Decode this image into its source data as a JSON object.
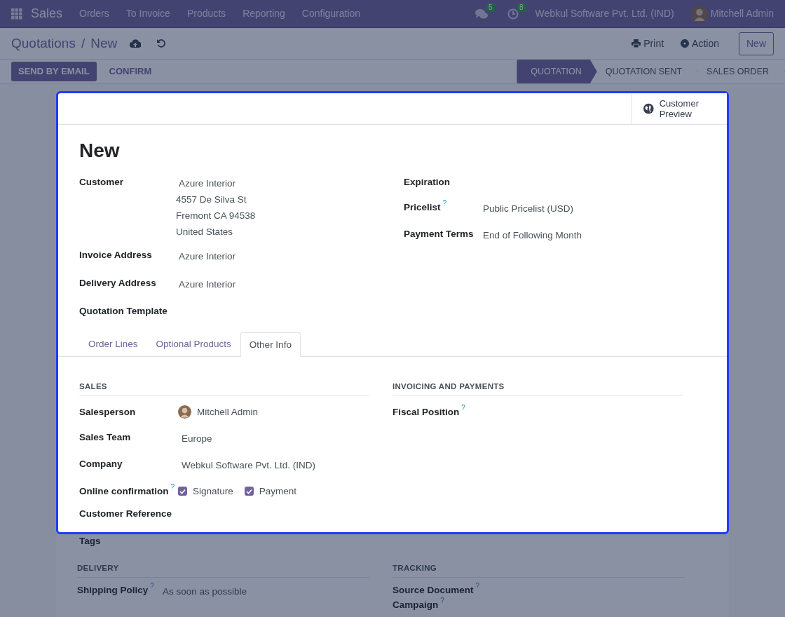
{
  "navbar": {
    "app_name": "Sales",
    "menu": [
      "Orders",
      "To Invoice",
      "Products",
      "Reporting",
      "Configuration"
    ],
    "messages_count": "5",
    "activities_count": "8",
    "company": "Webkul Software Pvt. Ltd. (IND)",
    "user": "Mitchell Admin"
  },
  "breadcrumb": {
    "parent": "Quotations",
    "separator": "/",
    "current": "New"
  },
  "top_actions": {
    "print": "Print",
    "action": "Action",
    "new": "New"
  },
  "buttons": [
    {
      "label": "SEND BY EMAIL",
      "kind": "primary"
    },
    {
      "label": "CONFIRM",
      "kind": "secondary"
    }
  ],
  "stages": [
    {
      "label": "QUOTATION",
      "selected": true
    },
    {
      "label": "QUOTATION SENT",
      "selected": false
    },
    {
      "label": "SALES ORDER",
      "selected": false
    }
  ],
  "spotlight": {
    "smart_button": "Customer Preview",
    "title": "New",
    "left_fields": [
      {
        "label": "Customer",
        "kind": "address",
        "value": "Azure Interior",
        "lines": [
          "4557 De Silva St",
          "Fremont CA 94538",
          "United States"
        ]
      },
      {
        "label": "Invoice Address",
        "kind": "text",
        "value": "Azure Interior"
      },
      {
        "label": "Delivery Address",
        "kind": "text",
        "value": "Azure Interior"
      },
      {
        "label": "Quotation Template"
      }
    ],
    "right_fields": [
      {
        "label": "Expiration"
      },
      {
        "label": "Pricelist",
        "help": "?",
        "kind": "text",
        "value": "Public Pricelist (USD)"
      },
      {
        "label": "Payment Terms",
        "kind": "text",
        "value": "End of Following Month"
      }
    ],
    "tabs": [
      {
        "label": "Order Lines",
        "selected": false
      },
      {
        "label": "Optional Products",
        "selected": false
      },
      {
        "label": "Other Info",
        "selected": true
      }
    ],
    "sections": [
      {
        "title": "SALES",
        "fields": [
          {
            "label": "Salesperson",
            "kind": "user",
            "value": "Mitchell Admin"
          },
          {
            "label": "Sales Team",
            "kind": "text",
            "value": "Europe"
          },
          {
            "label": "Company",
            "kind": "text",
            "value": "Webkul Software Pvt. Ltd. (IND)"
          },
          {
            "label": "Online confirmation",
            "help": "?",
            "kind": "checkboxes",
            "options": [
              {
                "label": "Signature",
                "checked": true
              },
              {
                "label": "Payment",
                "checked": true
              }
            ]
          },
          {
            "label": "Customer Reference"
          }
        ]
      },
      {
        "title": "INVOICING AND PAYMENTS",
        "fields": [
          {
            "label": "Fiscal Position",
            "help": "?"
          }
        ]
      }
    ]
  },
  "dimmed": {
    "fields": [
      {
        "label": "Tags"
      }
    ],
    "sections": [
      {
        "title": "DELIVERY",
        "fields": [
          {
            "label": "Shipping Policy",
            "help": "?",
            "kind": "text",
            "value": "As soon as possible"
          }
        ]
      },
      {
        "title": "TRACKING",
        "fields": [
          {
            "label": "Source Document",
            "help": "?"
          },
          {
            "label": "Campaign",
            "help": "?"
          }
        ]
      }
    ]
  }
}
